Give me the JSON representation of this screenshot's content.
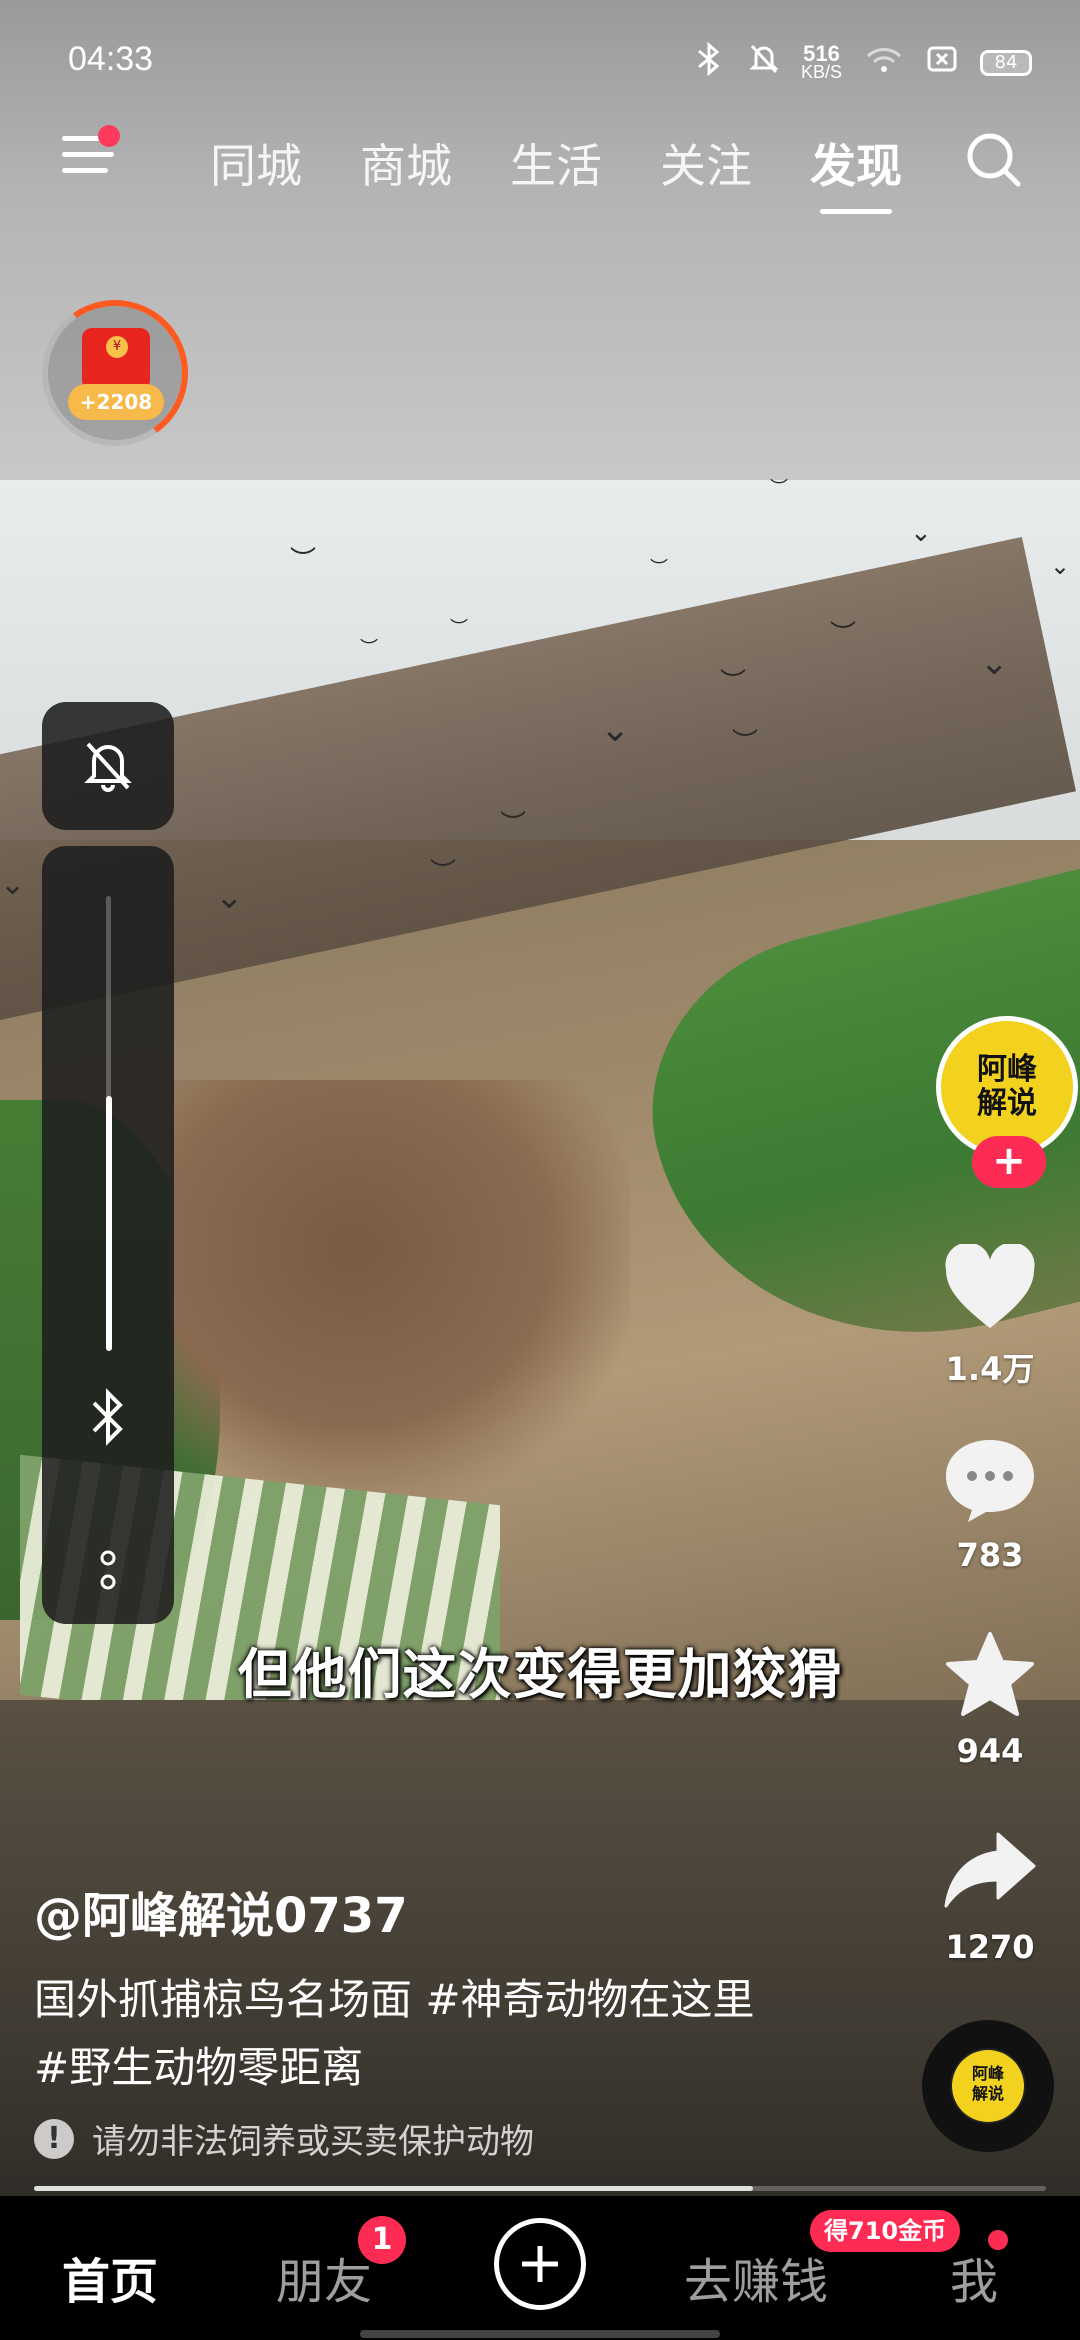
{
  "status_bar": {
    "time": "04:33",
    "net_speed_value": "516",
    "net_speed_unit": "KB/S",
    "battery": "84"
  },
  "top_nav": {
    "tabs": [
      {
        "label": "同城"
      },
      {
        "label": "商城"
      },
      {
        "label": "生活"
      },
      {
        "label": "关注"
      },
      {
        "label": "发现"
      }
    ],
    "active_tab": "发现"
  },
  "red_packet": {
    "amount": "+2208",
    "coin_symbol": "¥"
  },
  "video": {
    "subtitle": "但他们这次变得更加狡猾",
    "author": "@阿峰解说0737",
    "description": "国外抓捕椋鸟名场面 #神奇动物在这里 #野生动物零距离",
    "notice": "请勿非法饲养或买卖保护动物",
    "progress": 0.71
  },
  "creator": {
    "avatar_text_line1": "阿峰",
    "avatar_text_line2": "解说",
    "follow_label": "+"
  },
  "actions": {
    "like_count": "1.4万",
    "comment_count": "783",
    "favorite_count": "944",
    "share_count": "1270"
  },
  "volume": {
    "level": 0.56
  },
  "bottom_tabs": {
    "home": "首页",
    "friends": "朋友",
    "friends_badge": "1",
    "earn": "去赚钱",
    "earn_badge": "得710金币",
    "me": "我"
  },
  "colors": {
    "accent": "#fe2c55",
    "red_packet": "#e8251f",
    "avatar_bg": "#f3d21f"
  }
}
